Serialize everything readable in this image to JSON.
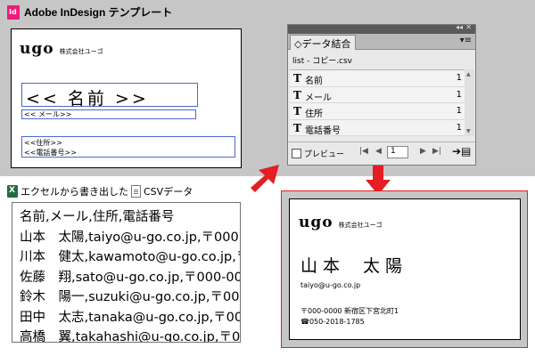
{
  "header": {
    "app_icon_label": "Id",
    "title": "Adobe InDesign テンプレート"
  },
  "template": {
    "logo": "ugo",
    "company": "株式会社ユーゴ",
    "name_placeholder": "<< 名前 >>",
    "mail_placeholder": "<< メール>>",
    "address_placeholder": "<<住所>>",
    "phone_placeholder": "<<電話番号>>"
  },
  "merge_panel": {
    "collapse_label": "◂◂",
    "close_label": "✕",
    "tab_label": "◇データ結合",
    "menu_label": "▾≡",
    "source_file": "list - コピー.csv",
    "fields": [
      {
        "icon": "T",
        "label": "名前",
        "count": "1"
      },
      {
        "icon": "T",
        "label": "メール",
        "count": "1"
      },
      {
        "icon": "T",
        "label": "住所",
        "count": "1"
      },
      {
        "icon": "T",
        "label": "電話番号",
        "count": "1"
      }
    ],
    "scroll_up": "▲",
    "scroll_down": "▼",
    "preview_label": "プレビュー",
    "nav": {
      "first": "|◀",
      "prev": "◀",
      "next": "▶",
      "last": "▶|"
    },
    "record_number": "1",
    "create_label": "➔▤"
  },
  "csv": {
    "caption_prefix": "エクセルから書き出した",
    "excel_icon_label": "X",
    "caption_suffix": "CSVデータ",
    "lines": [
      "名前,メール,住所,電話番号",
      "山本　太陽,taiyo@u-go.co.jp,〒000",
      "川本　健太,kawamoto@u-go.co.jp,〒",
      "佐藤　翔,sato@u-go.co.jp,〒000-00",
      "鈴木　陽一,suzuki@u-go.co.jp,〒000",
      "田中　太志,tanaka@u-go.co.jp,〒000",
      "高橋　翼,takahashi@u-go.co.jp,〒0"
    ]
  },
  "result": {
    "logo": "ugo",
    "company": "株式会社ユーゴ",
    "name_family": "山本",
    "name_given": "太陽",
    "mail": "taiyo@u-go.co.jp",
    "address": "〒000-0000 新宿区下宮北町1",
    "phone": "☎050-2018-1785"
  },
  "colors": {
    "gray_bg": "#c6c6c6",
    "arrow_red": "#e31e24",
    "field_blue": "#4b69c9",
    "indesign_pink": "#ed1c7a",
    "excel_green": "#1d6f42"
  }
}
